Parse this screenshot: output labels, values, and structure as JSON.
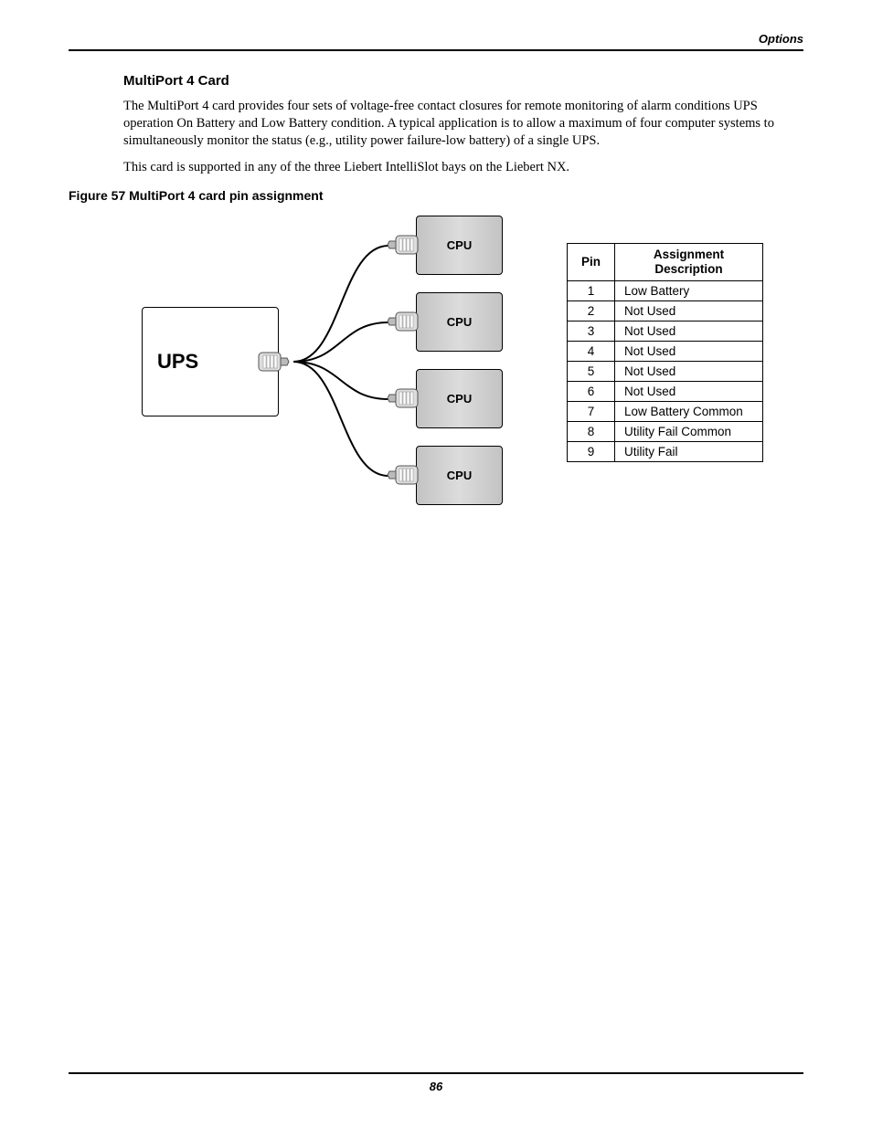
{
  "header": {
    "section_label": "Options"
  },
  "section": {
    "title": "MultiPort 4 Card"
  },
  "paragraphs": {
    "p1": "The MultiPort 4 card provides four sets of voltage-free contact closures for remote monitoring of alarm conditions UPS operation On Battery and Low Battery condition. A typical application is to allow a maximum of four computer systems to simultaneously monitor the status (e.g., utility power failure-low battery) of a single UPS.",
    "p2": "This card is supported in any of the three Liebert IntelliSlot bays on the Liebert NX."
  },
  "figure": {
    "caption": "Figure 57  MultiPort 4 card pin assignment",
    "ups_label": "UPS",
    "cpu_label": "CPU"
  },
  "table": {
    "headers": {
      "pin": "Pin",
      "desc": "Assignment Description"
    },
    "rows": [
      {
        "pin": "1",
        "desc": "Low Battery"
      },
      {
        "pin": "2",
        "desc": "Not Used"
      },
      {
        "pin": "3",
        "desc": "Not Used"
      },
      {
        "pin": "4",
        "desc": "Not Used"
      },
      {
        "pin": "5",
        "desc": "Not Used"
      },
      {
        "pin": "6",
        "desc": "Not Used"
      },
      {
        "pin": "7",
        "desc": "Low Battery Common"
      },
      {
        "pin": "8",
        "desc": "Utility Fail Common"
      },
      {
        "pin": "9",
        "desc": "Utility Fail"
      }
    ]
  },
  "footer": {
    "page_number": "86"
  }
}
